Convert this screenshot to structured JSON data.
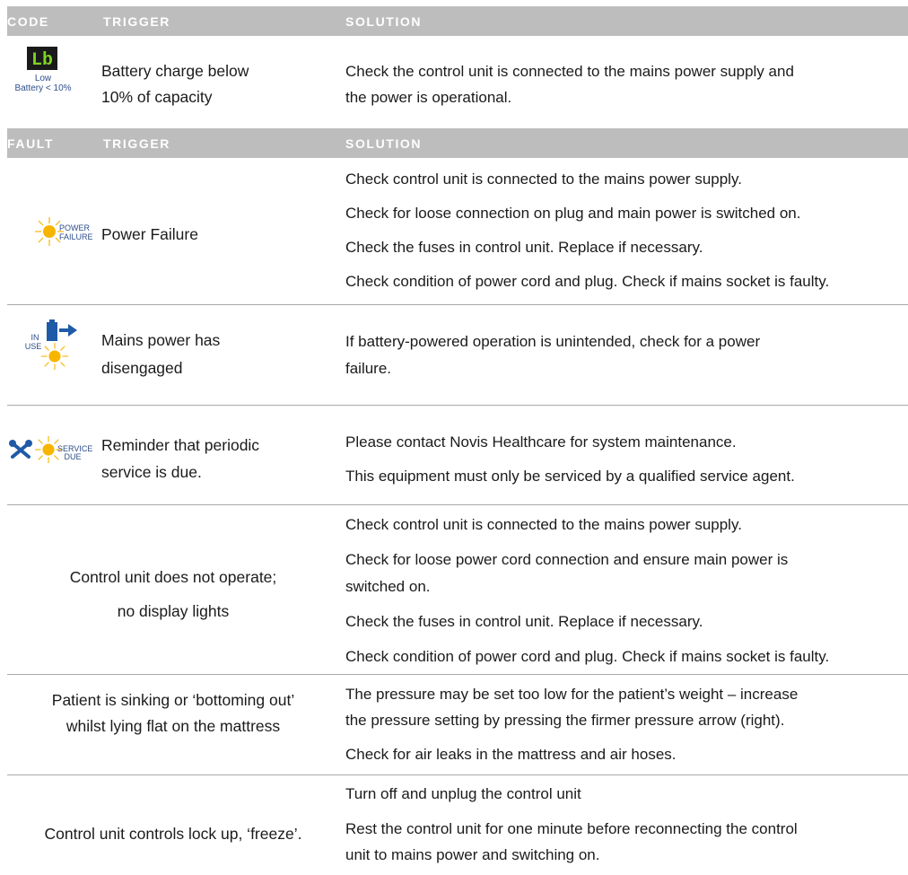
{
  "code_header": {
    "code": "CODE",
    "trigger": "TRIGGER",
    "solution": "SOLUTION"
  },
  "code_row": {
    "display": "Lb",
    "icon_label_1": "Low",
    "icon_label_2": "Battery < 10%",
    "trigger_1": "Battery charge below",
    "trigger_2": "10% of capacity",
    "solution_1": "Check the control unit is connected to the mains power supply and",
    "solution_2": "the power is operational."
  },
  "fault_header": {
    "fault": "FAULT",
    "trigger": "TRIGGER",
    "solution": "SOLUTION"
  },
  "power_failure": {
    "icon_label_1": "POWER",
    "icon_label_2": "FAILURE",
    "trigger": "Power Failure",
    "solutions": [
      "Check control unit is connected to the mains power supply.",
      "Check for loose connection on plug and main power is switched on.",
      "Check the fuses in control unit. Replace if necessary.",
      "Check condition of power cord and plug. Check if mains socket is faulty."
    ]
  },
  "mains_disengaged": {
    "icon_label_1": "IN",
    "icon_label_2": "USE",
    "trigger_1": "Mains power has",
    "trigger_2": "disengaged",
    "solution_1": "If battery-powered operation is unintended, check for a power",
    "solution_2": "failure."
  },
  "service_due": {
    "icon_label_1": "SERVICE",
    "icon_label_2": "DUE",
    "trigger_1": "Reminder that periodic",
    "trigger_2": "service is due.",
    "solutions": [
      "Please contact Novis Healthcare for system maintenance.",
      "This equipment must only be serviced by a qualified service agent."
    ]
  },
  "no_operate": {
    "trigger_1": "Control unit does not operate;",
    "trigger_2": "no display lights",
    "solutions": [
      "Check control unit is connected to the mains power supply.",
      "Check for loose power cord connection and ensure main power is",
      "switched on.",
      "Check the fuses in control unit. Replace if necessary.",
      "Check condition of power cord and plug. Check if mains socket is faulty."
    ]
  },
  "sinking": {
    "trigger_1": "Patient is sinking or ‘bottoming out’",
    "trigger_2": "whilst lying flat on the mattress",
    "solutions": [
      "The pressure may be set too low for the patient’s weight  – increase",
      "the pressure setting by pressing the firmer pressure arrow (right).",
      "Check for air leaks in the mattress and air hoses."
    ]
  },
  "freeze": {
    "trigger": "Control unit controls lock up, ‘freeze’.",
    "solutions": [
      "Turn off and unplug the control unit",
      "Rest the control unit for one minute before reconnecting the control",
      "unit to mains power and switching on."
    ]
  },
  "colors": {
    "header_bg": "#bdbdbd",
    "led_green": "#7ed321",
    "sun_yellow": "#f7b500",
    "icon_blue": "#1f5aa8"
  }
}
